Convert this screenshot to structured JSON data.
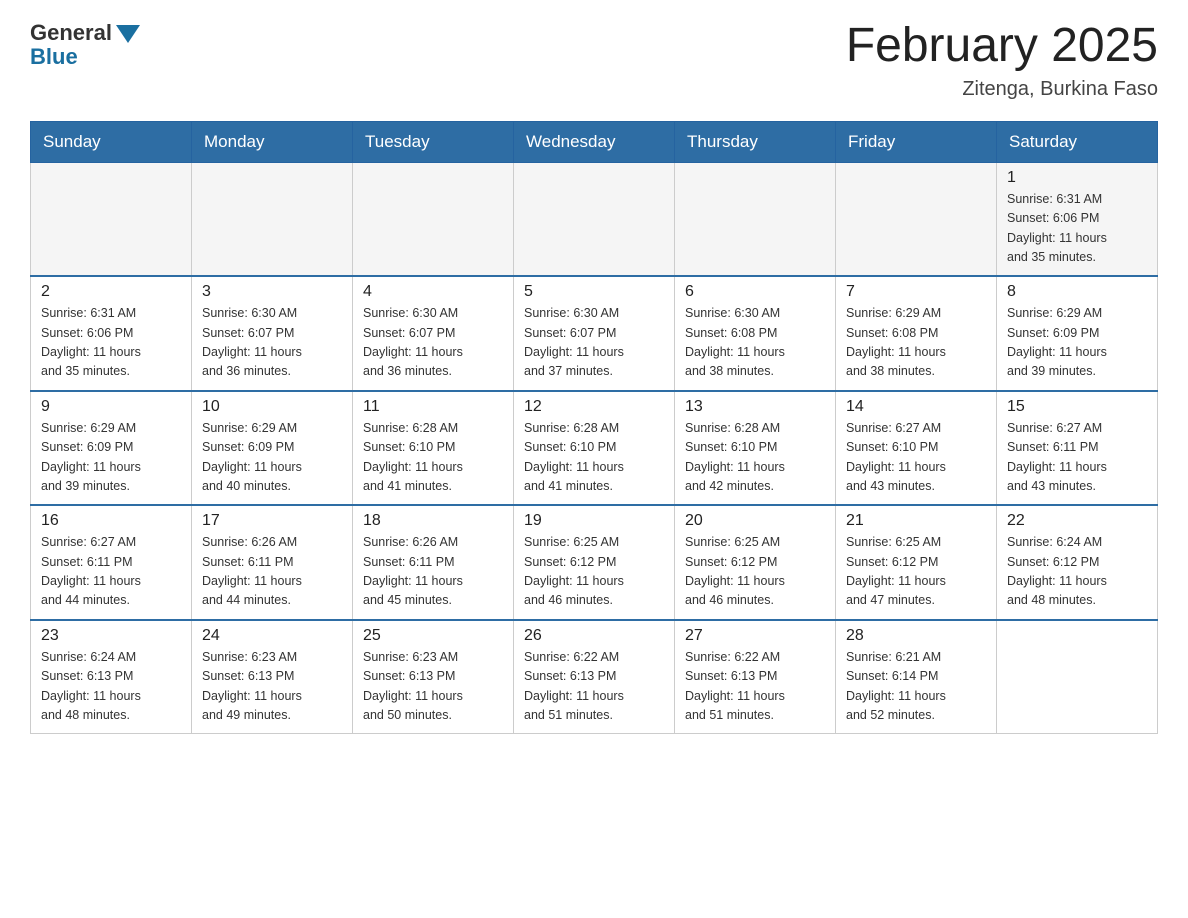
{
  "header": {
    "logo": {
      "general": "General",
      "blue": "Blue"
    },
    "title": "February 2025",
    "location": "Zitenga, Burkina Faso"
  },
  "weekdays": [
    "Sunday",
    "Monday",
    "Tuesday",
    "Wednesday",
    "Thursday",
    "Friday",
    "Saturday"
  ],
  "weeks": [
    {
      "days": [
        {
          "num": "",
          "info": ""
        },
        {
          "num": "",
          "info": ""
        },
        {
          "num": "",
          "info": ""
        },
        {
          "num": "",
          "info": ""
        },
        {
          "num": "",
          "info": ""
        },
        {
          "num": "",
          "info": ""
        },
        {
          "num": "1",
          "info": "Sunrise: 6:31 AM\nSunset: 6:06 PM\nDaylight: 11 hours\nand 35 minutes."
        }
      ]
    },
    {
      "days": [
        {
          "num": "2",
          "info": "Sunrise: 6:31 AM\nSunset: 6:06 PM\nDaylight: 11 hours\nand 35 minutes."
        },
        {
          "num": "3",
          "info": "Sunrise: 6:30 AM\nSunset: 6:07 PM\nDaylight: 11 hours\nand 36 minutes."
        },
        {
          "num": "4",
          "info": "Sunrise: 6:30 AM\nSunset: 6:07 PM\nDaylight: 11 hours\nand 36 minutes."
        },
        {
          "num": "5",
          "info": "Sunrise: 6:30 AM\nSunset: 6:07 PM\nDaylight: 11 hours\nand 37 minutes."
        },
        {
          "num": "6",
          "info": "Sunrise: 6:30 AM\nSunset: 6:08 PM\nDaylight: 11 hours\nand 38 minutes."
        },
        {
          "num": "7",
          "info": "Sunrise: 6:29 AM\nSunset: 6:08 PM\nDaylight: 11 hours\nand 38 minutes."
        },
        {
          "num": "8",
          "info": "Sunrise: 6:29 AM\nSunset: 6:09 PM\nDaylight: 11 hours\nand 39 minutes."
        }
      ]
    },
    {
      "days": [
        {
          "num": "9",
          "info": "Sunrise: 6:29 AM\nSunset: 6:09 PM\nDaylight: 11 hours\nand 39 minutes."
        },
        {
          "num": "10",
          "info": "Sunrise: 6:29 AM\nSunset: 6:09 PM\nDaylight: 11 hours\nand 40 minutes."
        },
        {
          "num": "11",
          "info": "Sunrise: 6:28 AM\nSunset: 6:10 PM\nDaylight: 11 hours\nand 41 minutes."
        },
        {
          "num": "12",
          "info": "Sunrise: 6:28 AM\nSunset: 6:10 PM\nDaylight: 11 hours\nand 41 minutes."
        },
        {
          "num": "13",
          "info": "Sunrise: 6:28 AM\nSunset: 6:10 PM\nDaylight: 11 hours\nand 42 minutes."
        },
        {
          "num": "14",
          "info": "Sunrise: 6:27 AM\nSunset: 6:10 PM\nDaylight: 11 hours\nand 43 minutes."
        },
        {
          "num": "15",
          "info": "Sunrise: 6:27 AM\nSunset: 6:11 PM\nDaylight: 11 hours\nand 43 minutes."
        }
      ]
    },
    {
      "days": [
        {
          "num": "16",
          "info": "Sunrise: 6:27 AM\nSunset: 6:11 PM\nDaylight: 11 hours\nand 44 minutes."
        },
        {
          "num": "17",
          "info": "Sunrise: 6:26 AM\nSunset: 6:11 PM\nDaylight: 11 hours\nand 44 minutes."
        },
        {
          "num": "18",
          "info": "Sunrise: 6:26 AM\nSunset: 6:11 PM\nDaylight: 11 hours\nand 45 minutes."
        },
        {
          "num": "19",
          "info": "Sunrise: 6:25 AM\nSunset: 6:12 PM\nDaylight: 11 hours\nand 46 minutes."
        },
        {
          "num": "20",
          "info": "Sunrise: 6:25 AM\nSunset: 6:12 PM\nDaylight: 11 hours\nand 46 minutes."
        },
        {
          "num": "21",
          "info": "Sunrise: 6:25 AM\nSunset: 6:12 PM\nDaylight: 11 hours\nand 47 minutes."
        },
        {
          "num": "22",
          "info": "Sunrise: 6:24 AM\nSunset: 6:12 PM\nDaylight: 11 hours\nand 48 minutes."
        }
      ]
    },
    {
      "days": [
        {
          "num": "23",
          "info": "Sunrise: 6:24 AM\nSunset: 6:13 PM\nDaylight: 11 hours\nand 48 minutes."
        },
        {
          "num": "24",
          "info": "Sunrise: 6:23 AM\nSunset: 6:13 PM\nDaylight: 11 hours\nand 49 minutes."
        },
        {
          "num": "25",
          "info": "Sunrise: 6:23 AM\nSunset: 6:13 PM\nDaylight: 11 hours\nand 50 minutes."
        },
        {
          "num": "26",
          "info": "Sunrise: 6:22 AM\nSunset: 6:13 PM\nDaylight: 11 hours\nand 51 minutes."
        },
        {
          "num": "27",
          "info": "Sunrise: 6:22 AM\nSunset: 6:13 PM\nDaylight: 11 hours\nand 51 minutes."
        },
        {
          "num": "28",
          "info": "Sunrise: 6:21 AM\nSunset: 6:14 PM\nDaylight: 11 hours\nand 52 minutes."
        },
        {
          "num": "",
          "info": ""
        }
      ]
    }
  ]
}
